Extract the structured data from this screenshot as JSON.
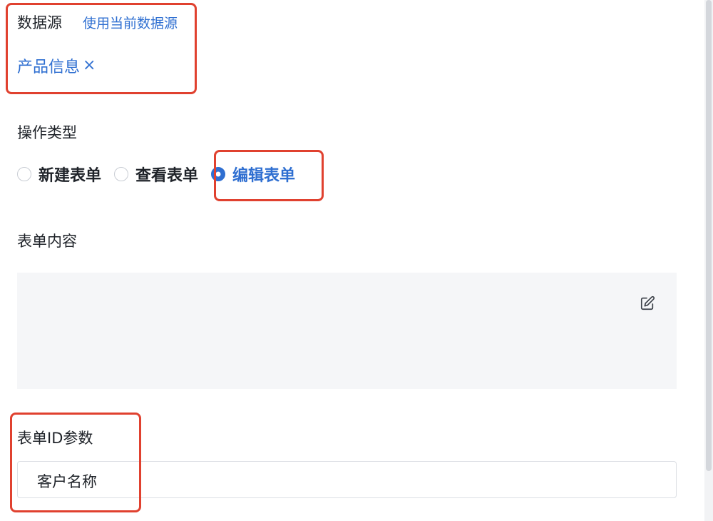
{
  "datasource": {
    "label": "数据源",
    "use_current_link": "使用当前数据源",
    "selected_tag": "产品信息",
    "remove_glyph": "×"
  },
  "operation": {
    "label": "操作类型",
    "options": [
      "新建表单",
      "查看表单",
      "编辑表单"
    ],
    "selected": "编辑表单"
  },
  "form_content": {
    "label": "表单内容"
  },
  "form_id_param": {
    "label": "表单ID参数",
    "value": "客户名称"
  },
  "colors": {
    "accent": "#2f6fd1",
    "highlight": "#e0412f",
    "content_bg": "#f5f6f8"
  }
}
